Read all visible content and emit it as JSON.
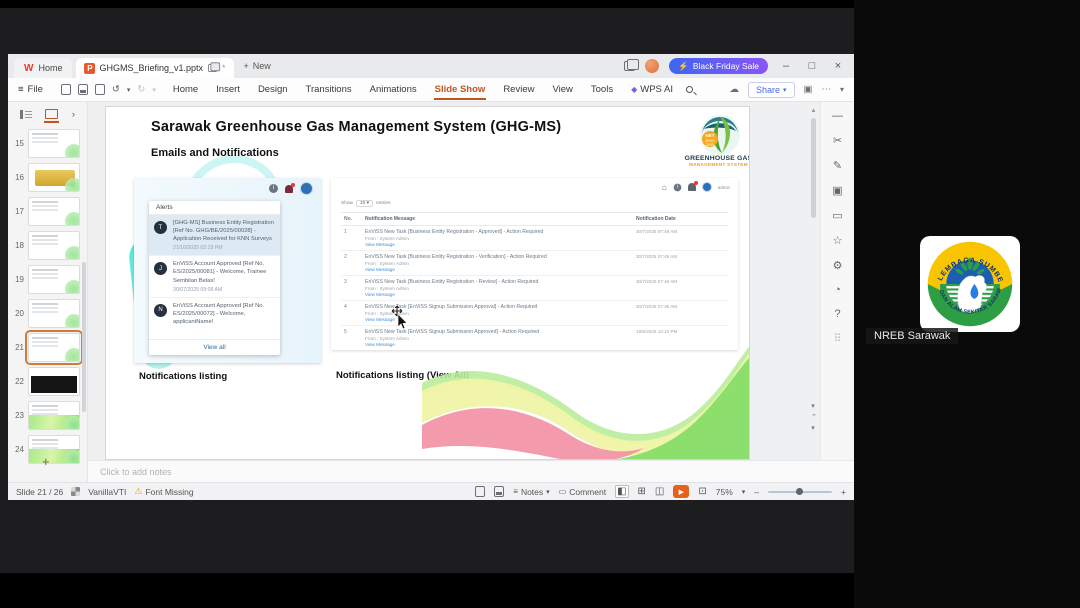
{
  "icons": {
    "hamburger": "≡",
    "undo": "↺",
    "redo": "↻",
    "caret": "▾",
    "chevron": "›",
    "minimize": "–",
    "maximize": "□",
    "close": "×",
    "cloud": "☁",
    "bolt": "⚡",
    "more": "⋯",
    "collapse": "▾",
    "warning": "⚠",
    "play": "▶",
    "plus": "+",
    "home": "⌂",
    "star": "☆",
    "gear": "⚙",
    "scissors": "✂",
    "pencil": "✎",
    "squares": "▣",
    "comment_box": "▭",
    "clock": "◔",
    "help": "?",
    "grid": "⠿",
    "dash": "—",
    "sparkle": "◆",
    "view_normal": "◧",
    "view_sorter": "⊞",
    "view_read": "◫",
    "fullscreen": "⊡",
    "up": "▴",
    "down": "▾",
    "uptick": "⌃"
  },
  "titlebar": {
    "home_tab": "Home",
    "doc_title": "GHGMS_Briefing_v1.pptx",
    "unsaved": "*",
    "new_label": "New",
    "promo": "Black Friday Sale",
    "p_badge": "P",
    "w_logo": "W"
  },
  "menubar": {
    "file": "File",
    "items": [
      "Home",
      "Insert",
      "Design",
      "Transitions",
      "Animations",
      "Slide Show",
      "Review",
      "View",
      "Tools"
    ],
    "wps_ai": "WPS AI",
    "share": "Share"
  },
  "slide_panel": {
    "numbers": [
      "15",
      "16",
      "17",
      "18",
      "19",
      "20",
      "21",
      "22",
      "23",
      "24"
    ],
    "selected": "21"
  },
  "slide": {
    "title": "Sarawak Greenhouse Gas Management System (GHG-MS)",
    "subtitle": "Emails and Notifications",
    "logo": {
      "badge": "NET ZERO 2050",
      "line1": "GREENHOUSE GAS",
      "line2": "MANAGEMENT SYSTEM"
    },
    "caption_left": "Notifications listing",
    "caption_right": "Notifications listing (View All)",
    "alerts": {
      "header": "Alerts",
      "view_all": "View all",
      "items": [
        {
          "avatar": "T",
          "text": "[GHG-MS] Business Entity Registration [Ref No. GHG/BE/2025/00028] - Application Received for KNN Surveys",
          "time": "21/10/2025 02:19 PM"
        },
        {
          "avatar": "J",
          "text": "EnViSS Account Approved [Ref No. ES/2025/00081] - Welcome, Trainee Sembilan Belas!",
          "time": "30/07/2025 09:09 AM"
        },
        {
          "avatar": "N",
          "text": "EnViSS Account Approved [Ref No. ES/2025/00072] - Welcome, applicantName!",
          "time": ""
        }
      ]
    },
    "table": {
      "show": "Show",
      "per_page": "10",
      "entries": "entries",
      "user": "admin",
      "headers": {
        "no": "No.",
        "message": "Notification Message",
        "date": "Notification Date"
      },
      "from": "From : System Admin",
      "view_message": "View Message",
      "rows": [
        {
          "no": "1",
          "message": "EnViSS New Task [Business Entity Registration - Approved] - Action Required",
          "date": "30/7/2025 07:49 AM"
        },
        {
          "no": "2",
          "message": "EnViSS New Task [Business Entity Registration - Verification] - Action Required",
          "date": "30/7/2025 07:49 AM"
        },
        {
          "no": "3",
          "message": "EnViSS New Task [Business Entity Registration - Review] - Action Required",
          "date": "30/7/2025 07:46 AM"
        },
        {
          "no": "4",
          "message": "EnViSS New Task [EnViSS Signup Submission Approval] - Action Required",
          "date": "30/7/2025 07:39 AM"
        },
        {
          "no": "5",
          "message": "EnViSS New Task [EnViSS Signup Submission Approved] - Action Required",
          "date": "18/6/2025 12:10 PM"
        }
      ]
    }
  },
  "notes": {
    "placeholder": "Click to add notes"
  },
  "statusbar": {
    "slide_indicator": "Slide 21 / 26",
    "theme": "VanillaVTI",
    "font_warning": "Font Missing",
    "notes": "Notes",
    "comment": "Comment",
    "zoom": "75%"
  },
  "participant": {
    "name": "NREB Sarawak",
    "logo_top": "LEMBAGA SUMBER ASLI",
    "logo_bottom": "DAN ALAM SEKITAR SARAWAK"
  },
  "colors": {
    "accent_orange": "#c0561f",
    "promo_from": "#3f66f4",
    "promo_to": "#8b55f7",
    "play": "#e8611c",
    "link_blue": "#3f8fd8"
  }
}
